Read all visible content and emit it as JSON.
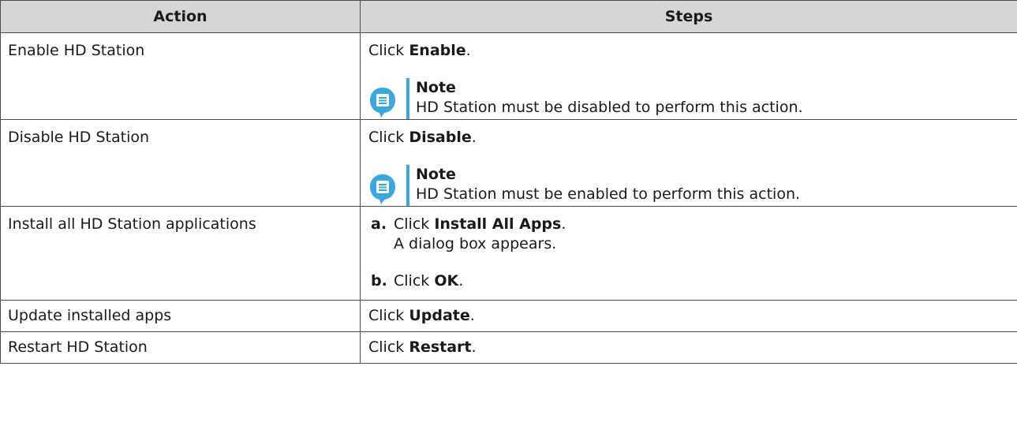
{
  "table": {
    "headers": {
      "action": "Action",
      "steps": "Steps"
    },
    "rows": [
      {
        "action": "Enable HD Station",
        "step_prefix": "Click ",
        "step_bold": "Enable",
        "step_suffix": ".",
        "note_title": "Note",
        "note_text": "HD Station must be disabled to perform this action."
      },
      {
        "action": "Disable HD Station",
        "step_prefix": "Click ",
        "step_bold": "Disable",
        "step_suffix": ".",
        "note_title": "Note",
        "note_text": "HD Station must be enabled to perform this action."
      },
      {
        "action": "Install all HD Station applications",
        "step_a_letter": "a.",
        "step_a_prefix": "Click ",
        "step_a_bold": "Install All Apps",
        "step_a_suffix": ".",
        "step_a_sub": "A dialog box appears.",
        "step_b_letter": "b.",
        "step_b_prefix": "Click ",
        "step_b_bold": "OK",
        "step_b_suffix": "."
      },
      {
        "action": "Update installed apps",
        "step_prefix": "Click ",
        "step_bold": "Update",
        "step_suffix": "."
      },
      {
        "action": "Restart HD Station",
        "step_prefix": "Click ",
        "step_bold": "Restart",
        "step_suffix": "."
      }
    ]
  },
  "colors": {
    "header_bg": "#d6d6d6",
    "note_accent": "#3aa8e0",
    "border": "#4a4a4a"
  },
  "icons": {
    "note": "note-icon"
  }
}
